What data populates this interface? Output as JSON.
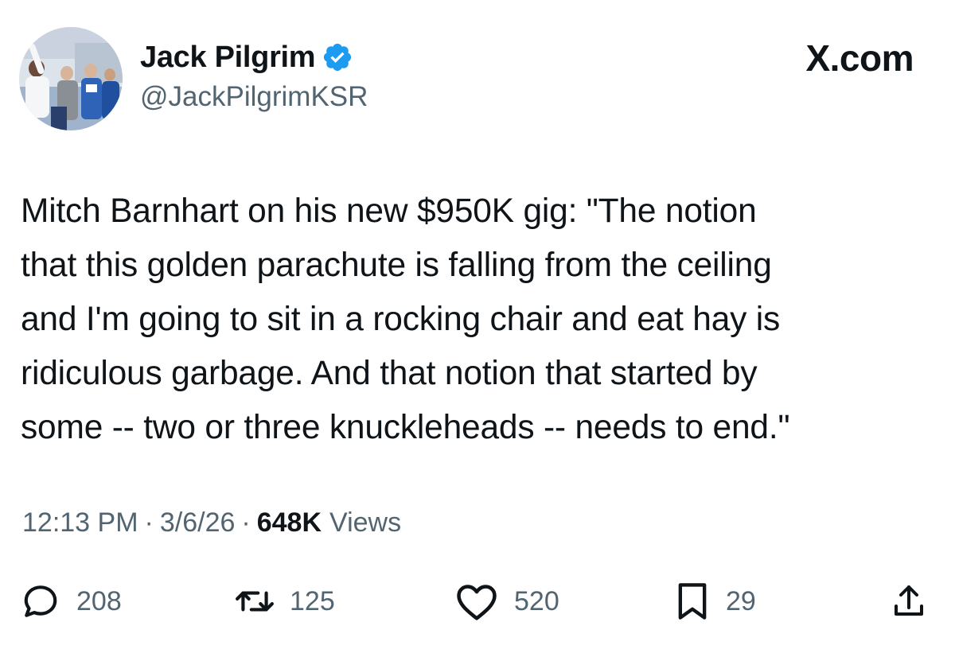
{
  "author": {
    "display_name": "Jack Pilgrim",
    "handle": "@JackPilgrimKSR",
    "verified": true
  },
  "brand": "X.com",
  "tweet": {
    "text": "Mitch Barnhart on his new $950K gig: \"The notion\nthat this golden parachute is falling from the ceiling\nand I'm going to sit in a rocking chair and eat hay is\nridiculous garbage. And that notion that started by\nsome -- two or three knuckleheads -- needs to end.\"",
    "time": "12:13 PM",
    "separator": "·",
    "date": "3/6/26",
    "views_count": "648K",
    "views_label": "Views"
  },
  "actions": {
    "replies": "208",
    "reposts": "125",
    "likes": "520",
    "bookmarks": "29"
  },
  "colors": {
    "text": "#0f1419",
    "secondary": "#536471",
    "verified_badge": "#1d9bf0"
  },
  "icons": {
    "reply": "reply-icon",
    "repost": "repost-icon",
    "like": "heart-icon",
    "bookmark": "bookmark-icon",
    "share": "share-icon",
    "verified": "verified-badge-icon"
  }
}
